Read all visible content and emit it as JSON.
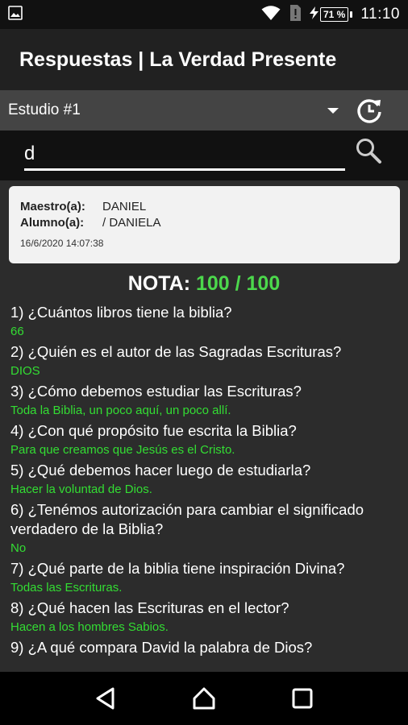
{
  "status_bar": {
    "time": "11:10",
    "battery": "71 %",
    "icons": [
      "image-icon",
      "wifi-icon",
      "sim-alert-icon",
      "charging-icon",
      "battery-icon"
    ]
  },
  "app_bar": {
    "title": "Respuestas | La Verdad Presente"
  },
  "study": {
    "selected": "Estudio #1"
  },
  "search": {
    "value": "d"
  },
  "info": {
    "teacher_key": "Maestro(a):",
    "teacher_value": "DANIEL",
    "student_key": "Alumno(a):",
    "student_value": "/ DANIELA",
    "date": "16/6/2020 14:07:38"
  },
  "score": {
    "label": "NOTA: ",
    "value": "100 / 100"
  },
  "items": [
    {
      "q": "1) ¿Cuántos libros tiene la biblia?",
      "a": "66"
    },
    {
      "q": "2) ¿Quién es el autor de las Sagradas Escrituras?",
      "a": "DIOS"
    },
    {
      "q": "3) ¿Cómo debemos estudiar las Escrituras?",
      "a": "Toda la Biblia, un poco aquí, un poco allí."
    },
    {
      "q": "4) ¿Con qué propósito fue escrita la Biblia?",
      "a": "Para que creamos que Jesús es el Cristo."
    },
    {
      "q": "5) ¿Qué debemos hacer luego de estudiarla?",
      "a": "Hacer la voluntad de Dios."
    },
    {
      "q": "6) ¿Tenémos autorización para cambiar el significado verdadero de la Biblia?",
      "a": "No"
    },
    {
      "q": "7) ¿Qué parte de la biblia tiene inspiración Divina?",
      "a": "Todas las Escrituras."
    },
    {
      "q": "8) ¿Qué hacen las Escrituras en el lector?",
      "a": "Hacen a los hombres Sabios."
    },
    {
      "q": "9) ¿A qué compara David la palabra de Dios?",
      "a": ""
    }
  ],
  "colors": {
    "accent_green": "#4cd84c",
    "answer_green": "#33dd33",
    "app_bar": "#212121",
    "background": "#2c2c2c"
  },
  "nav_icons": [
    "back-icon",
    "home-icon",
    "recents-icon"
  ]
}
